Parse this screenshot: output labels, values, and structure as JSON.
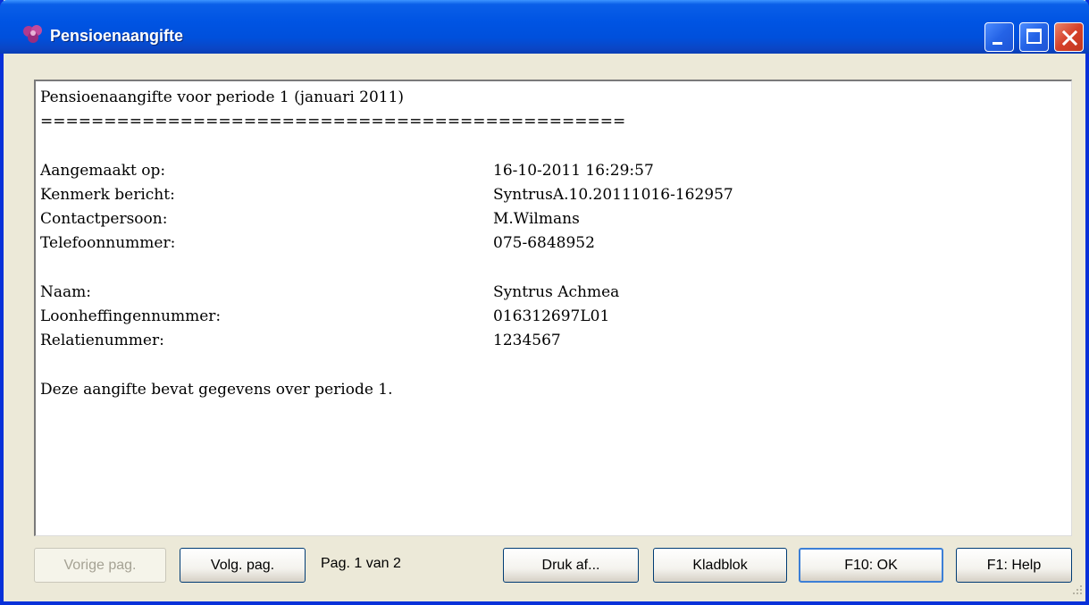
{
  "window": {
    "title": "Pensioenaangifte",
    "icon": "purple-flower-icon",
    "controls": [
      "minimize-icon",
      "maximize-icon",
      "close-icon"
    ]
  },
  "report": {
    "heading": "Pensioenaangifte voor periode 1 (januari 2011)",
    "underline": "==============================================",
    "fields1": [
      {
        "label": "Aangemaakt op:",
        "value": "16-10-2011 16:29:57"
      },
      {
        "label": "Kenmerk bericht:",
        "value": "SyntrusA.10.20111016-162957"
      },
      {
        "label": "Contactpersoon:",
        "value": "M.Wilmans"
      },
      {
        "label": "Telefoonnummer:",
        "value": "075-6848952"
      }
    ],
    "fields2": [
      {
        "label": "Naam:",
        "value": "Syntrus Achmea"
      },
      {
        "label": "Loonheffingennummer:",
        "value": "016312697L01"
      },
      {
        "label": "Relatienummer:",
        "value": "1234567"
      }
    ],
    "footer": "Deze aangifte bevat gegevens over periode 1."
  },
  "buttons": {
    "prev": "Vorige pag.",
    "next": "Volg. pag.",
    "print": "Druk af...",
    "notepad": "Kladblok",
    "ok": "F10: OK",
    "help": "F1: Help"
  },
  "pagination": {
    "text": "Pag. 1 van 2",
    "current": 1,
    "total": 2
  },
  "colors": {
    "titlebar": "#0054e3",
    "close_button": "#d6412a",
    "window_bg": "#ece9d8",
    "disabled_text": "#a5a294"
  }
}
